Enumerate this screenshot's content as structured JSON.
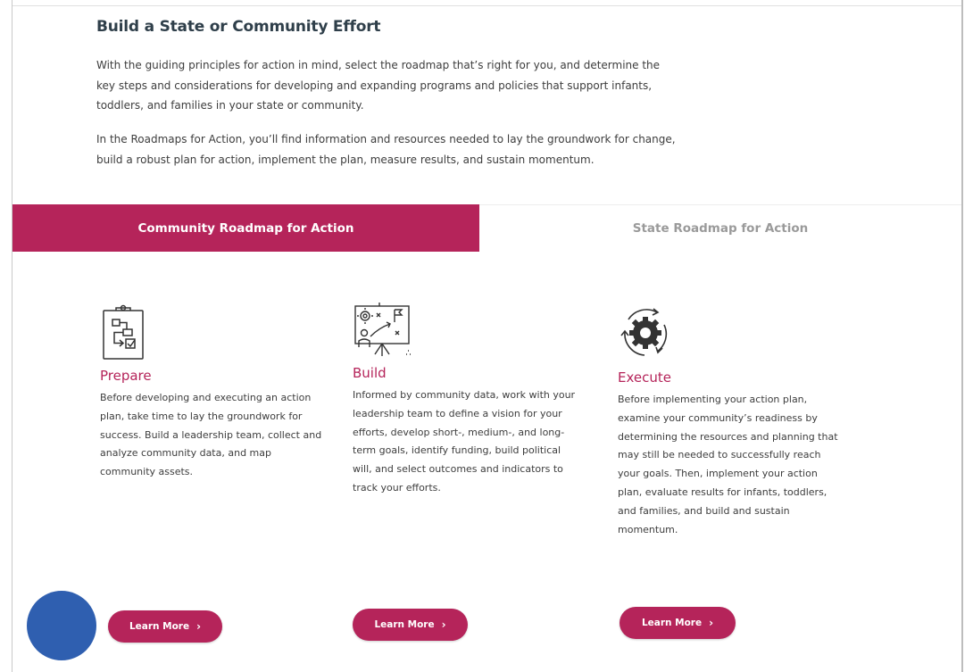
{
  "section": {
    "heading": "Build a State or Community Effort",
    "intro_p1": "With the guiding principles for action in mind, select the roadmap that’s right for you, and determine the key steps and considerations for developing and expanding programs and policies that support infants, toddlers, and families in your state or community.",
    "intro_p2": "In the Roadmaps for Action, you’ll find information and resources needed to lay the groundwork for change, build a robust plan for action, implement the plan, measure results, and sustain momentum."
  },
  "tabs": [
    {
      "label": "Community Roadmap for Action",
      "active": true
    },
    {
      "label": "State Roadmap for Action",
      "active": false
    }
  ],
  "cards": [
    {
      "title": "Prepare",
      "icon": "clipboard-flowchart-icon",
      "description": "Before developing and executing an action plan, take time to lay the groundwork for success. Build a leadership team, collect and analyze community data, and map community assets.",
      "button": "Learn More"
    },
    {
      "title": "Build",
      "icon": "presentation-strategy-icon",
      "description": "Informed by community data, work with your leadership team to define a vision for your efforts, develop short-, medium-, and long-term goals, identify funding, build political will, and select outcomes and indicators to track your efforts.",
      "button": "Learn More"
    },
    {
      "title": "Execute",
      "icon": "gear-cycle-icon",
      "description": "Before implementing your action plan, examine your community’s readiness by determining the resources and planning that may still be needed to successfully reach your goals. Then, implement your action plan, evaluate results for infants, toddlers, and families, and build and sustain momentum.",
      "button": "Learn More"
    }
  ],
  "colors": {
    "accent": "#b5245a",
    "heading": "#2f3f4a",
    "inactive_tab_text": "#9a9a9a",
    "chat_bubble": "#2f5fb0"
  }
}
